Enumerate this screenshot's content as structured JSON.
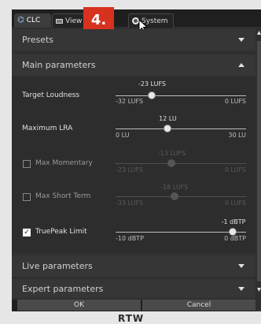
{
  "tabs": [
    {
      "label": "CLC",
      "icon": "waveform-icon"
    },
    {
      "label": "View",
      "icon": "window-icon"
    },
    {
      "label": "System",
      "icon": "gear-icon"
    }
  ],
  "marker": "4.",
  "sections": {
    "presets": "Presets",
    "main": "Main parameters",
    "live": "Live parameters",
    "expert": "Expert parameters"
  },
  "params": {
    "target_loudness": {
      "label": "Target Loudness",
      "value": "-23 LUFS",
      "min": "-32 LUFS",
      "max": "0 LUFS",
      "fraction": 0.28
    },
    "maximum_lra": {
      "label": "Maximum LRA",
      "value": "12 LU",
      "min": "0 LU",
      "max": "30 LU",
      "fraction": 0.4
    },
    "max_momentary": {
      "label": "Max Momentary",
      "value": "-13 LUFS",
      "min": "-23 LUFS",
      "max": "0 LUFS",
      "fraction": 0.43,
      "checked": false
    },
    "max_short_term": {
      "label": "Max Short Term",
      "value": "-18 LUFS",
      "min": "-33 LUFS",
      "max": "0 LUFS",
      "fraction": 0.45,
      "checked": false
    },
    "truepeak_limit": {
      "label": "TruePeak Limit",
      "value": "-1 dBTP",
      "min": "-10 dBTP",
      "max": "0 dBTP",
      "fraction": 0.9,
      "checked": true
    }
  },
  "buttons": {
    "ok": "OK",
    "cancel": "Cancel"
  },
  "logo": "RTW",
  "colors": {
    "marker": "#d7321f",
    "panel": "#2d2d2d",
    "tabbar": "#1f1f1f"
  }
}
